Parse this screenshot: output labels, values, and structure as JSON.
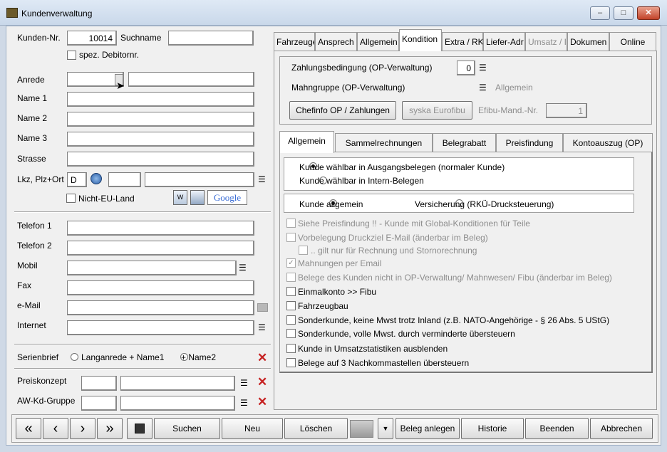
{
  "window": {
    "title": "Kundenverwaltung",
    "controls": [
      "‒",
      "□",
      "✕"
    ]
  },
  "left": {
    "kunden_nr_label": "Kunden-Nr.",
    "kunden_nr_value": "10014",
    "suchname_label": "Suchname",
    "spez_label": "spez. Debitornr.",
    "anrede_label": "Anrede",
    "name1_label": "Name 1",
    "name2_label": "Name 2",
    "name3_label": "Name 3",
    "strasse_label": "Strasse",
    "lkz_label": "Lkz, Plz+Ort",
    "lkz_value": "D",
    "nicht_eu_label": "Nicht-EU-Land",
    "google_label": "Google",
    "telefon1_label": "Telefon 1",
    "telefon2_label": "Telefon 2",
    "mobil_label": "Mobil",
    "fax_label": "Fax",
    "email_label": "e-Mail",
    "internet_label": "Internet",
    "serienbrief_label": "Serienbrief",
    "radio_langanrede": "Langanrede + Name1",
    "radio_name2": "+ Name2",
    "preiskonzept_label": "Preiskonzept",
    "awkd_label": "AW-Kd-Gruppe"
  },
  "tabs": [
    {
      "label": "Fahrzeuge"
    },
    {
      "label": "Ansprech"
    },
    {
      "label": "Allgemein"
    },
    {
      "label": "Kondition"
    },
    {
      "label": "Extra / RK"
    },
    {
      "label": "Liefer-Adr"
    },
    {
      "label": "Umsatz / I"
    },
    {
      "label": "Dokumen"
    },
    {
      "label": "Online"
    }
  ],
  "kondition": {
    "zahlungs_label": "Zahlungsbedingung (OP-Verwaltung)",
    "zahlungs_value": "0",
    "mahn_label": "Mahngruppe (OP-Verwaltung)",
    "mahn_value": "Allgemein",
    "chefinfo_btn": "Chefinfo OP / Zahlungen",
    "syska_btn": "syska Eurofibu",
    "efibu_label": "Efibu-Mand.-Nr.",
    "efibu_value": "1"
  },
  "inner_tabs": [
    {
      "label": "Allgemein"
    },
    {
      "label": "Sammelrechnungen"
    },
    {
      "label": "Belegrabatt"
    },
    {
      "label": "Preisfindung"
    },
    {
      "label": "Kontoauszug (OP)"
    }
  ],
  "allgemein": {
    "radio_ausgang": "Kunde wählbar in Ausgangsbelegen (normaler Kunde)",
    "radio_intern": "Kunde wählbar in Intern-Belegen",
    "radio_allgemein": "Kunde allgemein",
    "radio_versicherung": "Versicherung (RKÜ-Drucksteuerung)",
    "cb1": "Siehe Preisfindung !! - Kunde mit Global-Konditionen für Teile",
    "cb2": "Vorbelegung Druckziel E-Mail (änderbar im Beleg)",
    "cb3": ".. gilt nur für Rechnung und Stornorechnung",
    "cb4": "Mahnungen per Email",
    "cb5": "Belege des Kunden nicht in OP-Verwaltung/ Mahnwesen/ Fibu (änderbar im Beleg)",
    "cb6": "Einmalkonto >> Fibu",
    "cb7": "Fahrzeugbau",
    "cb8": "Sonderkunde, keine Mwst trotz Inland (z.B. NATO-Angehörige - § 26 Abs. 5 UStG)",
    "cb9": "Sonderkunde, volle Mwst. durch verminderte übersteuern",
    "cb10": "Kunde in Umsatzstatistiken ausblenden",
    "cb11": "Belege auf 3 Nachkommastellen übersteuern"
  },
  "bottom": {
    "first": "«",
    "prev": "‹",
    "next": "›",
    "last": "»",
    "suchen": "Suchen",
    "neu": "Neu",
    "loeschen": "Löschen",
    "beleg": "Beleg anlegen",
    "historie": "Historie",
    "beenden": "Beenden",
    "abbrechen": "Abbrechen"
  }
}
